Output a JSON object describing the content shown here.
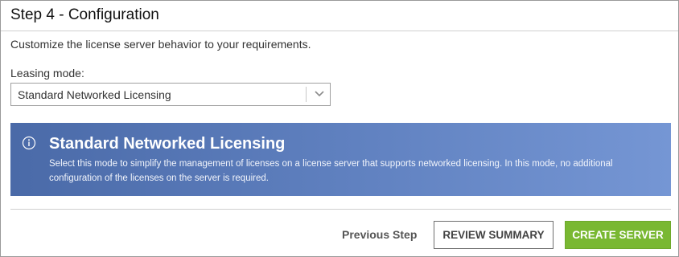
{
  "header": {
    "title": "Step 4 - Configuration"
  },
  "intro_text": "Customize the license server behavior to your requirements.",
  "leasing": {
    "label": "Leasing mode:",
    "selected": "Standard Networked Licensing"
  },
  "info_banner": {
    "title": "Standard Networked Licensing",
    "description": "Select this mode to simplify the management of licenses on a license server that supports networked licensing. In this mode, no additional configuration of the licenses on the server is required."
  },
  "footer": {
    "previous_label": "Previous Step",
    "review_label": "REVIEW SUMMARY",
    "create_label": "CREATE SERVER"
  },
  "colors": {
    "banner_start": "#4a6aa8",
    "banner_end": "#7596d4",
    "create_button": "#79b832"
  },
  "icons": {
    "select_chevron": "chevron-down-icon",
    "banner_info": "info-icon"
  }
}
